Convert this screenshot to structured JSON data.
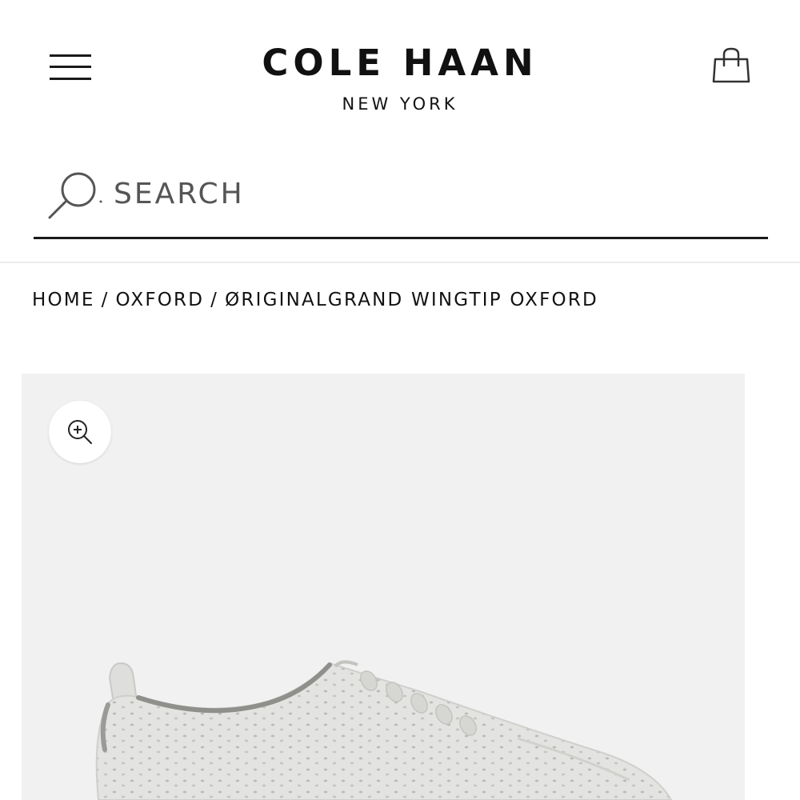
{
  "header": {
    "brand_name": "COLE HAAN",
    "brand_subtitle": "NEW YORK",
    "menu_icon": "hamburger-menu-icon",
    "bag_icon": "shopping-bag-icon"
  },
  "search": {
    "placeholder": "SEARCH",
    "icon": "search-icon"
  },
  "breadcrumb": {
    "items": [
      "HOME",
      "OXFORD",
      "ØRIGINALGRAND WINGTIP OXFORD"
    ],
    "separator": "/"
  },
  "product": {
    "zoom_icon": "zoom-in-icon",
    "image_subject": "shoe-image"
  },
  "colors": {
    "text": "#1a1a1a",
    "image_background": "#f1f1f1",
    "divider": "#ececec"
  }
}
